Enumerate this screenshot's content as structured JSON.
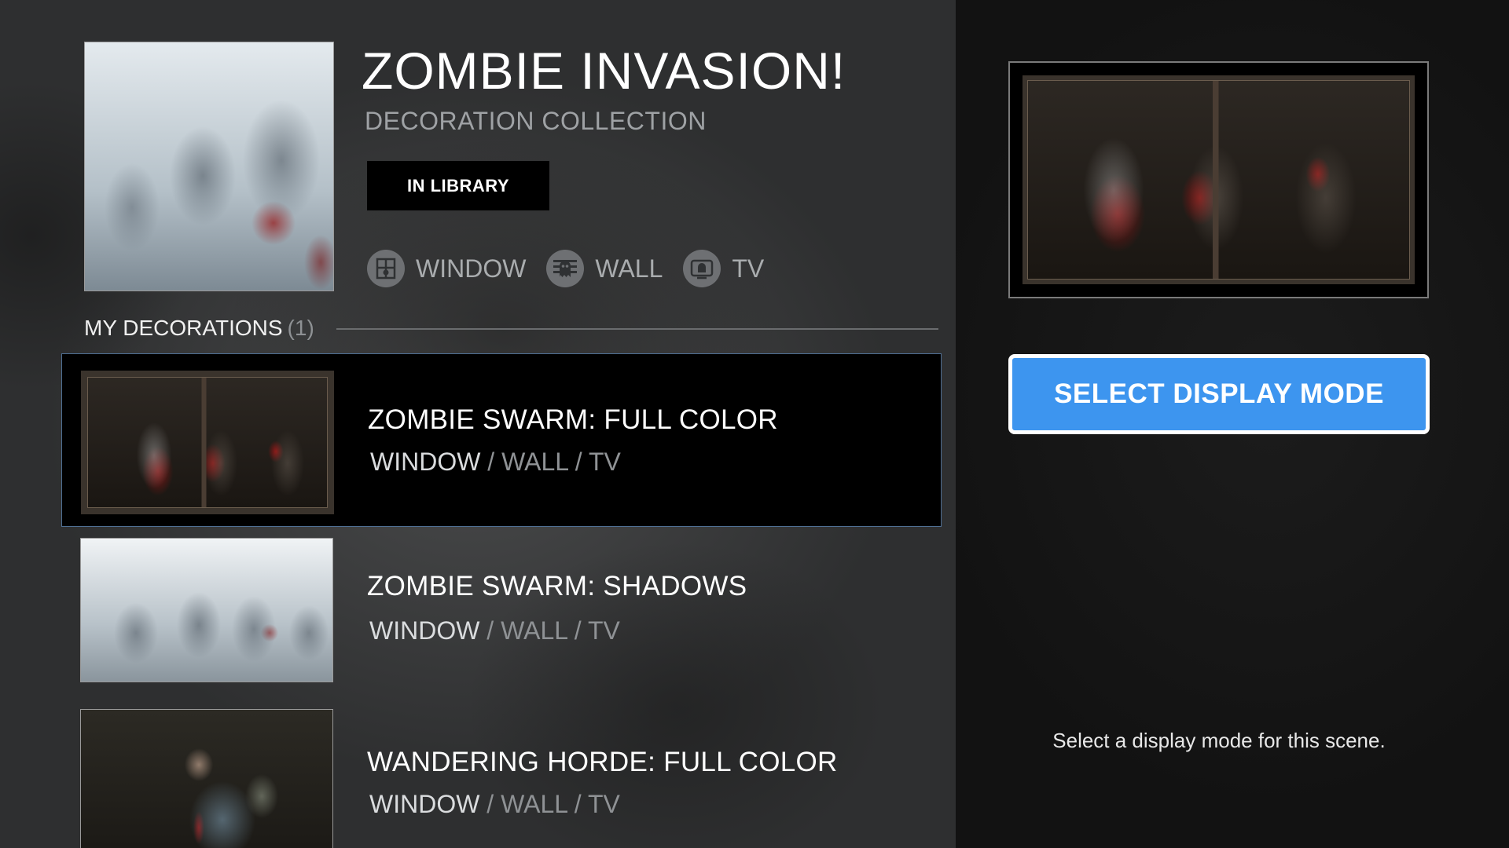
{
  "collection": {
    "title": "ZOMBIE INVASION!",
    "subtitle": "DECORATION COLLECTION",
    "badge": "IN LIBRARY",
    "modes": [
      {
        "label": "WINDOW",
        "icon": "window-icon"
      },
      {
        "label": "WALL",
        "icon": "ghost-icon"
      },
      {
        "label": "TV",
        "icon": "tv-icon"
      }
    ]
  },
  "section": {
    "title": "MY DECORATIONS",
    "count": "(1)"
  },
  "decorations": [
    {
      "title": "ZOMBIE SWARM: FULL COLOR",
      "mode_primary": "WINDOW",
      "mode_sep1": " / ",
      "mode_second": "WALL",
      "mode_sep2": " / ",
      "mode_third": "TV",
      "selected": true
    },
    {
      "title": "ZOMBIE SWARM: SHADOWS",
      "mode_primary": "WINDOW",
      "mode_sep1": " / ",
      "mode_second": "WALL",
      "mode_sep2": " / ",
      "mode_third": "TV",
      "selected": false
    },
    {
      "title": "WANDERING HORDE: FULL COLOR",
      "mode_primary": "WINDOW",
      "mode_sep1": " / ",
      "mode_second": "WALL",
      "mode_sep2": " / ",
      "mode_third": "TV",
      "selected": false
    }
  ],
  "detail": {
    "select_button": "SELECT DISPLAY MODE",
    "hint": "Select a display mode for this scene."
  },
  "colors": {
    "accent": "#3d95ef",
    "selected_border": "#4f6f93",
    "right_background": "#141414"
  }
}
